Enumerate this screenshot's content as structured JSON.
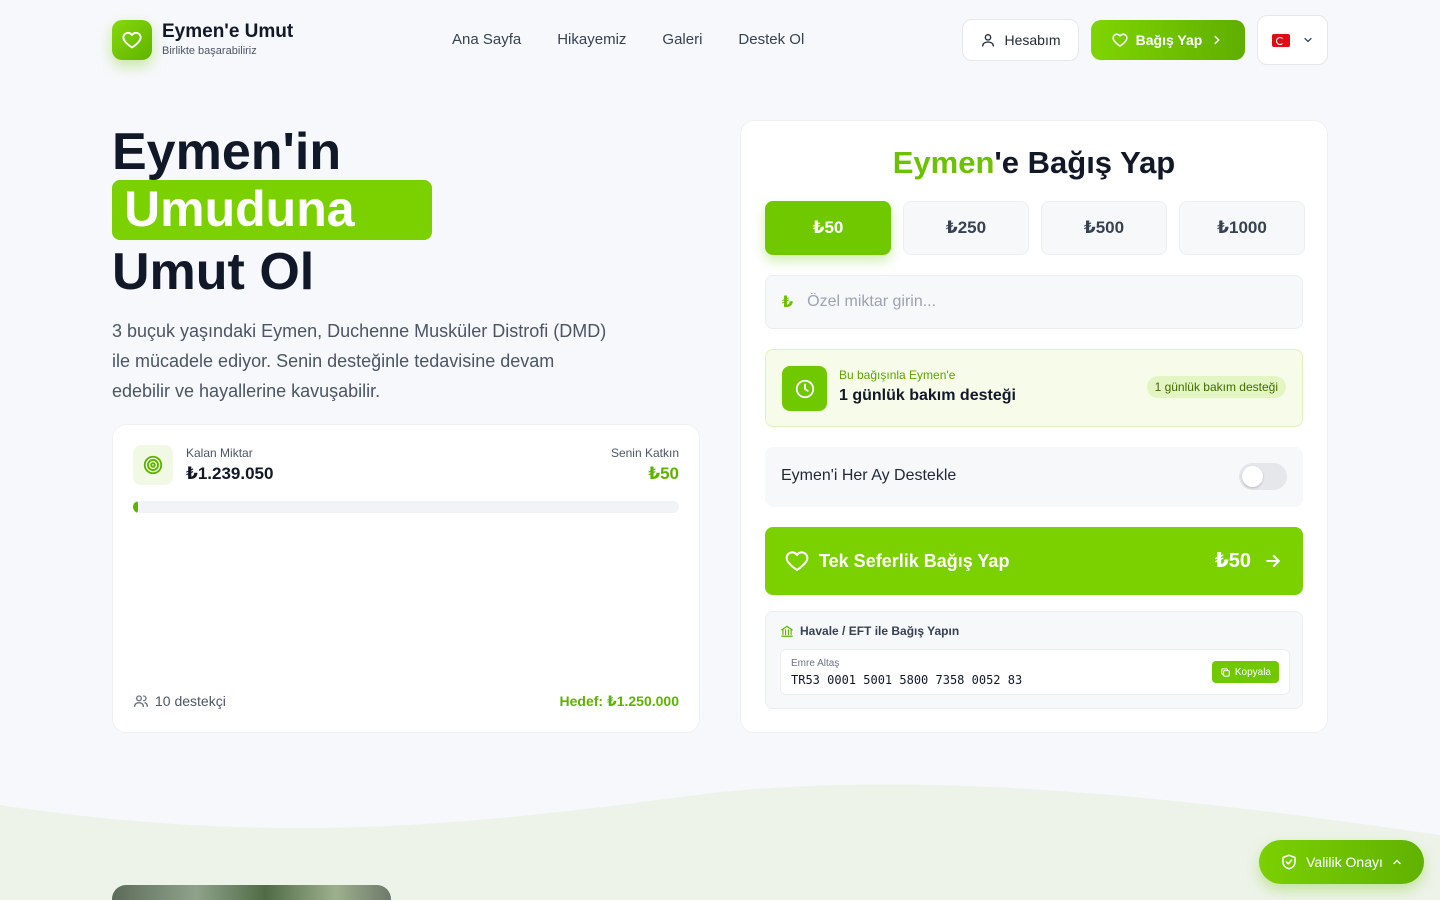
{
  "header": {
    "brand_title": "Eymen'e Umut",
    "brand_subtitle": "Birlikte başarabiliriz",
    "nav": [
      "Ana Sayfa",
      "Hikayemiz",
      "Galeri",
      "Destek Ol"
    ],
    "account_label": "Hesabım",
    "donate_label": "Bağış Yap",
    "language": "tr"
  },
  "hero": {
    "line1": "Eymen'in",
    "highlight": "Umuduna",
    "line3": "Umut Ol",
    "description": "3 buçuk yaşındaki Eymen, Duchenne Musküler Distrofi (DMD) ile mücadele ediyor. Senin desteğinle tedavisine devam edebilir ve hayallerine kavuşabilir."
  },
  "progress": {
    "remaining_label": "Kalan Miktar",
    "remaining_value": "₺1.239.050",
    "you_label": "Senin Katkın",
    "you_value": "₺50",
    "percent": 0.9,
    "supporters": "10 destekçi",
    "goal": "Hedef: ₺1.250.000"
  },
  "donate": {
    "title_highlight": "Eymen",
    "title_rest": "'e Bağış Yap",
    "amounts": [
      "₺50",
      "₺250",
      "₺500",
      "₺1000"
    ],
    "selected_index": 0,
    "currency_symbol": "₺",
    "custom_placeholder": "Özel miktar girin...",
    "impact_small": "Bu bağışınla Eymen'e",
    "impact_big": "1 günlük bakım desteği",
    "impact_badge": "1 günlük bakım desteği",
    "monthly_label": "Eymen'i Her Ay Destekle",
    "monthly_enabled": false,
    "main_button_label": "Tek Seferlik Bağış Yap",
    "main_button_amount": "₺50",
    "bank_title": "Havale / EFT ile Bağış Yapın",
    "iban_name": "Emre Altaş",
    "iban": "TR53 0001 5001 5800 7358 0052 83",
    "copy_label": "Kopyala"
  },
  "floating": {
    "valilik_label": "Valilik Onayı"
  },
  "colors": {
    "accent": "#7bd000",
    "accent_dark": "#5fb300"
  }
}
